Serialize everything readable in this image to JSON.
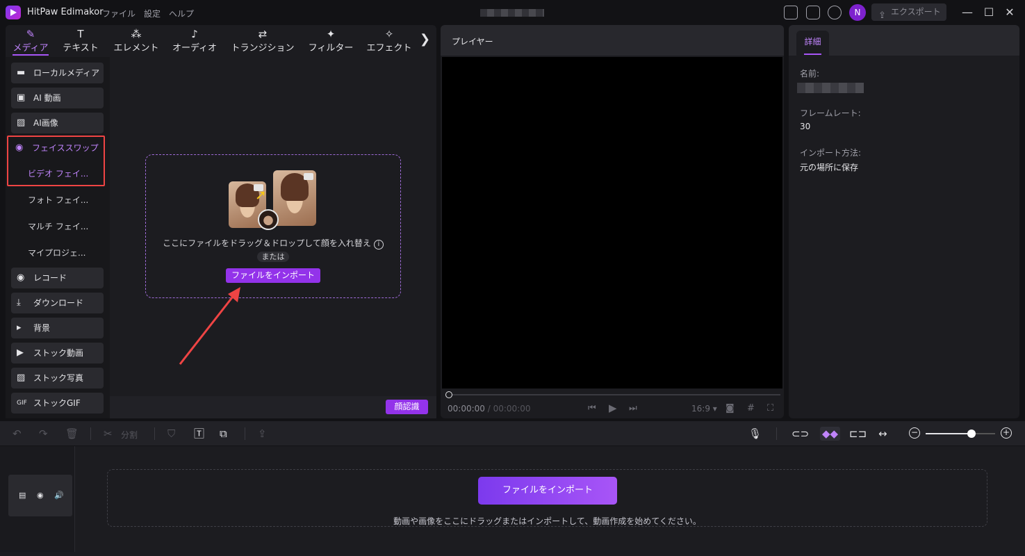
{
  "app": {
    "name": "HitPaw Edimakor"
  },
  "menu": [
    "ファイル",
    "設定",
    "ヘルプ"
  ],
  "header": {
    "avatar": "N",
    "export_label": "エクスポート"
  },
  "media_tabs": [
    {
      "label": "メディア",
      "icon": "media-icon"
    },
    {
      "label": "テキスト",
      "icon": "text-icon"
    },
    {
      "label": "エレメント",
      "icon": "elements-icon"
    },
    {
      "label": "オーディオ",
      "icon": "audio-icon"
    },
    {
      "label": "トランジション",
      "icon": "transition-icon"
    },
    {
      "label": "フィルター",
      "icon": "filter-icon"
    },
    {
      "label": "エフェクト",
      "icon": "effect-icon"
    }
  ],
  "sidebar": {
    "items": [
      {
        "label": "ローカルメディア",
        "icon": "folder-icon"
      },
      {
        "label": "AI 動画",
        "icon": "ai-video-icon"
      },
      {
        "label": "AI画像",
        "icon": "ai-image-icon"
      },
      {
        "label": "フェイススワップ",
        "icon": "faceswap-icon"
      },
      {
        "label": "ビデオ フェイ...",
        "icon": ""
      },
      {
        "label": "フォト フェイ...",
        "icon": ""
      },
      {
        "label": "マルチ フェイ...",
        "icon": ""
      },
      {
        "label": "マイプロジェ...",
        "icon": ""
      },
      {
        "label": "レコード",
        "icon": "record-icon"
      },
      {
        "label": "ダウンロード",
        "icon": "download-icon"
      },
      {
        "label": "背景",
        "icon": "triangle-icon"
      },
      {
        "label": "ストック動画",
        "icon": "stock-video-icon"
      },
      {
        "label": "ストック写真",
        "icon": "stock-photo-icon"
      },
      {
        "label": "ストックGIF",
        "icon": "gif-icon"
      }
    ]
  },
  "dropzone": {
    "text": "ここにファイルをドラッグ＆ドロップして顔を入れ替え",
    "or_label": "または",
    "import_label": "ファイルをインポート"
  },
  "face_recog_label": "顔認識",
  "player": {
    "title": "プレイヤー",
    "time_current": "00:00:00",
    "time_total": "/ 00:00:00",
    "aspect": "16:9"
  },
  "details": {
    "tab_label": "詳細",
    "name_label": "名前:",
    "framerate_label": "フレームレート:",
    "framerate_value": "30",
    "import_method_label": "インポート方法:",
    "import_method_value": "元の場所に保存"
  },
  "timeline": {
    "split_label": "分割",
    "import_label": "ファイルをインポート",
    "hint": "動画や画像をここにドラッグまたはインポートして、動画作成を始めてください。"
  },
  "colors": {
    "accent": "#a855f7",
    "button": "#9333ea",
    "highlight": "#ef4444"
  }
}
